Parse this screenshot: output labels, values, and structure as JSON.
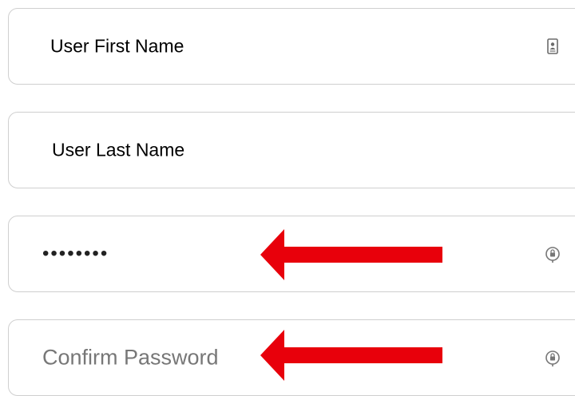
{
  "form": {
    "first_name": {
      "value": "User First Name",
      "icon": "contact-card-icon"
    },
    "last_name": {
      "value": "User Last Name"
    },
    "password": {
      "masked_value": "••••••••",
      "icon": "password-key-icon"
    },
    "confirm_password": {
      "placeholder": "Confirm Password",
      "icon": "password-key-icon"
    }
  },
  "annotations": {
    "arrow_color": "#e8000b",
    "arrows": [
      "points-to-password-field",
      "points-to-confirm-password-field"
    ]
  },
  "colors": {
    "field_border": "#cfcfcf",
    "placeholder": "#777777",
    "text": "#000000"
  }
}
